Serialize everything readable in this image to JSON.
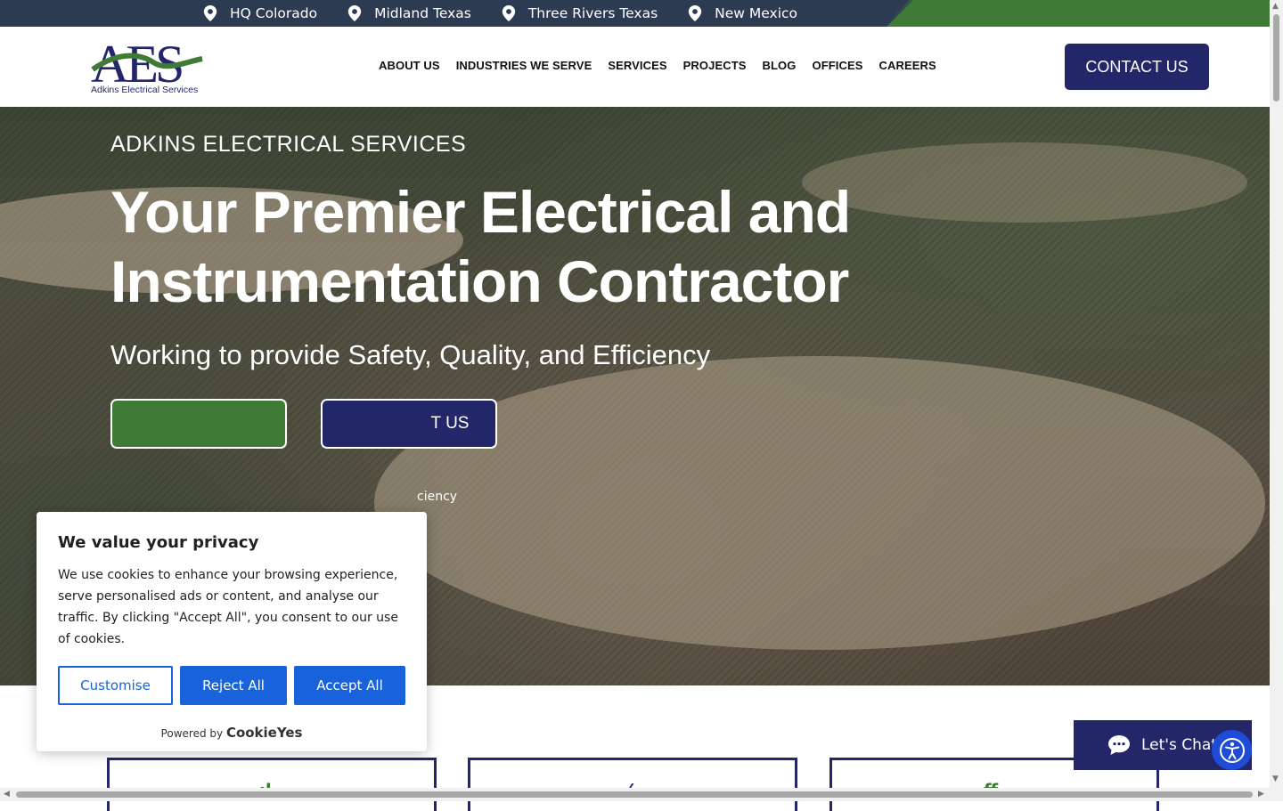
{
  "topbar": {
    "locations": [
      "HQ Colorado",
      "Midland Texas",
      "Three Rivers Texas",
      "New Mexico"
    ]
  },
  "header": {
    "logo_text": "AES",
    "logo_tagline": "Adkins Electrical Services",
    "nav": [
      "ABOUT US",
      "INDUSTRIES WE SERVE",
      "SERVICES",
      "PROJECTS",
      "BLOG",
      "OFFICES",
      "CAREERS"
    ],
    "contact_label": "CONTACT US"
  },
  "hero": {
    "eyebrow": "ADKINS ELECTRICAL SERVICES",
    "headline_line1": "Your Premier Electrical and",
    "headline_line2": "Instrumentation Contractor",
    "subheading": "Working to provide Safety, Quality, and Efficiency",
    "primary_button": "",
    "secondary_button": "T US",
    "small_text": "ciency"
  },
  "cookie": {
    "title": "We value your privacy",
    "body": "We use cookies to enhance your browsing experience, serve personalised ads or content, and analyse our traffic. By clicking \"Accept All\", you consent to our use of cookies.",
    "customise": "Customise",
    "reject": "Reject All",
    "accept": "Accept All",
    "powered_by": "Powered by",
    "brand": "CookieYes"
  },
  "chat": {
    "label": "Let's Chat!"
  },
  "colors": {
    "navy": "#23276a",
    "green": "#3f7a37",
    "cookie_blue": "#1863dc"
  }
}
